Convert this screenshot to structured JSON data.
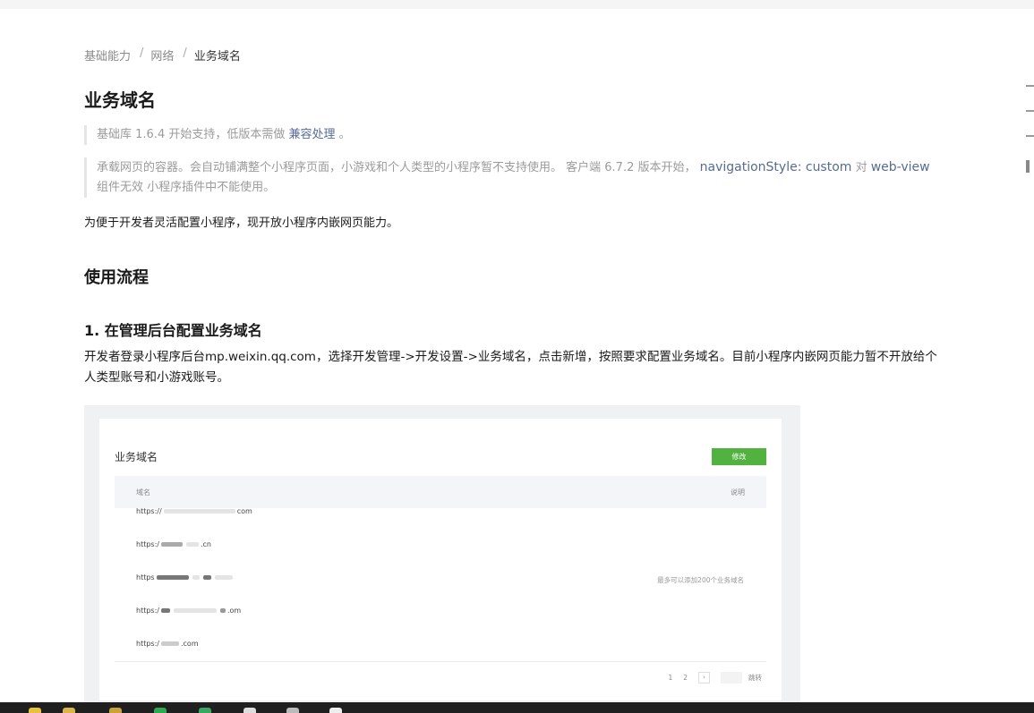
{
  "breadcrumb": {
    "item1": "基础能力",
    "sep": "/",
    "item2": "网络",
    "current": "业务域名"
  },
  "title": "业务域名",
  "note1": {
    "prefix": "基础库 1.6.4 开始支持，低版本需做",
    "link": "兼容处理",
    "suffix": "。"
  },
  "note2": {
    "text1": "承载网页的容器。会自动铺满整个小程序页面，小游戏和个人类型的小程序暂不支持使用。 客户端 6.7.2 版本开始，",
    "code": "navigationStyle: custom",
    "text2": "对",
    "code2": "web-view",
    "text3": "组件无效 小程序插件中不能使用。"
  },
  "intro": "为便于开发者灵活配置小程序，现开放小程序内嵌网页能力。",
  "section_title": "使用流程",
  "step1_title": "1. 在管理后台配置业务域名",
  "step1_text": "开发者登录小程序后台mp.weixin.qq.com，选择开发管理->开发设置->业务域名，点击新增，按照要求配置业务域名。目前小程序内嵌网页能力暂不开放给个人类型账号和小游戏账号。",
  "screenshot": {
    "card_title": "业务域名",
    "edit_button": "修改",
    "col_domain": "域名",
    "col_desc": "说明",
    "rows": [
      {
        "prefix": "https://",
        "suffix": "com"
      },
      {
        "prefix": "https:/",
        "suffix": ".cn"
      },
      {
        "prefix": "https",
        "suffix": ""
      },
      {
        "prefix": "https:/",
        "suffix": ".om"
      },
      {
        "prefix": "https:/",
        "suffix": ".com"
      }
    ],
    "desc_note": "最多可以添加200个业务域名",
    "pager": {
      "p1": "1",
      "p2": "2",
      "next": "›",
      "jump": "跳转"
    }
  },
  "colors": {
    "link": "#576b95",
    "button_green": "#52b23f",
    "muted": "#9b9b9b"
  }
}
